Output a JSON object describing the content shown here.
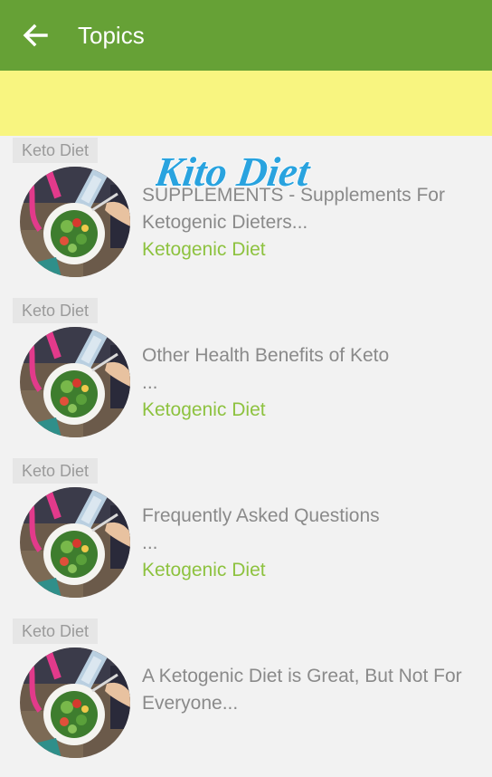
{
  "appbar": {
    "title": "Topics",
    "back_icon": "arrow-left-icon"
  },
  "banner": {
    "logo_text": "Kito Diet"
  },
  "colors": {
    "appbar": "#66a136",
    "banner": "#f8f580",
    "category": "#8dc23f",
    "logo": "#29a3df"
  },
  "items": [
    {
      "tag": "Keto Diet",
      "title_line1": "SUPPLEMENTS - Supplements For",
      "title_line2": "Ketogenic Dieters...",
      "category": "Ketogenic Diet"
    },
    {
      "tag": "Keto Diet",
      "title_line1": "Other Health Benefits of Keto",
      "title_line2": "...",
      "category": "Ketogenic Diet"
    },
    {
      "tag": "Keto Diet",
      "title_line1": "Frequently Asked Questions",
      "title_line2": "...",
      "category": "Ketogenic Diet"
    },
    {
      "tag": "Keto Diet",
      "title_line1": "A Ketogenic Diet is Great, But Not For",
      "title_line2": "Everyone...",
      "category": ""
    }
  ]
}
